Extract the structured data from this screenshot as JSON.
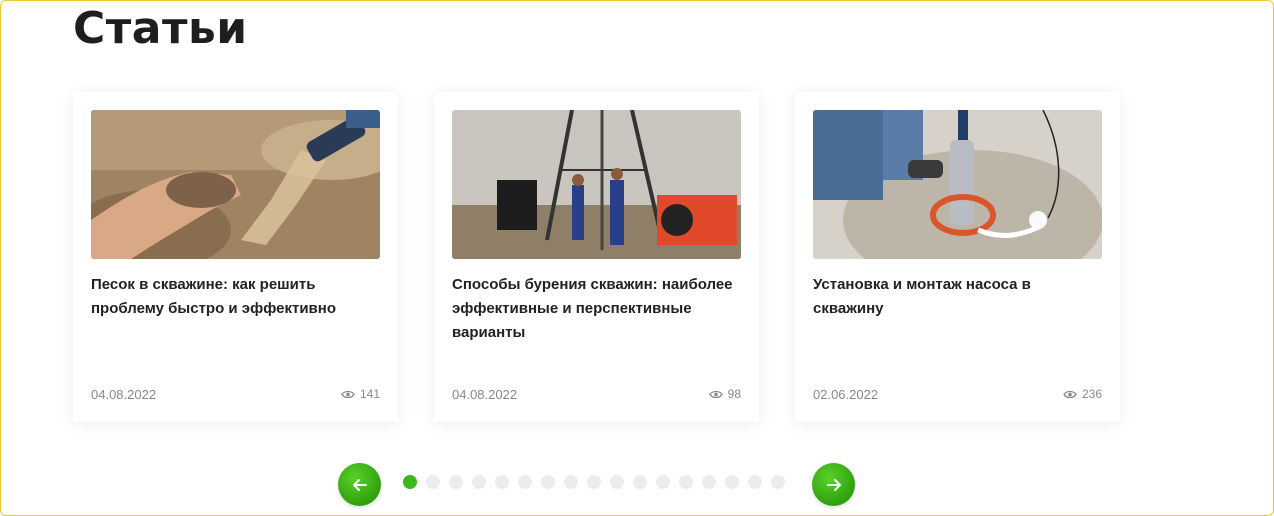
{
  "section": {
    "title": "Статьи"
  },
  "articles": [
    {
      "title": "Песок в скважине: как решить проблему быстро и эффективно",
      "date": "04.08.2022",
      "views": "141",
      "image": "sand-water-photo"
    },
    {
      "title": "Способы бурения скважин: наиболее эффективные и перспективные варианты",
      "date": "04.08.2022",
      "views": "98",
      "image": "drilling-rig-photo"
    },
    {
      "title": "Установка и монтаж насоса в скважину",
      "date": "02.06.2022",
      "views": "236",
      "image": "pump-installation-photo"
    }
  ],
  "slider": {
    "total_dots": 17,
    "active_index": 0
  },
  "icons": {
    "prev": "arrow-left-icon",
    "next": "arrow-right-icon",
    "views": "eye-icon"
  },
  "colors": {
    "accent": "#3cb81b",
    "border": "#e9c93a",
    "muted": "#888888"
  }
}
